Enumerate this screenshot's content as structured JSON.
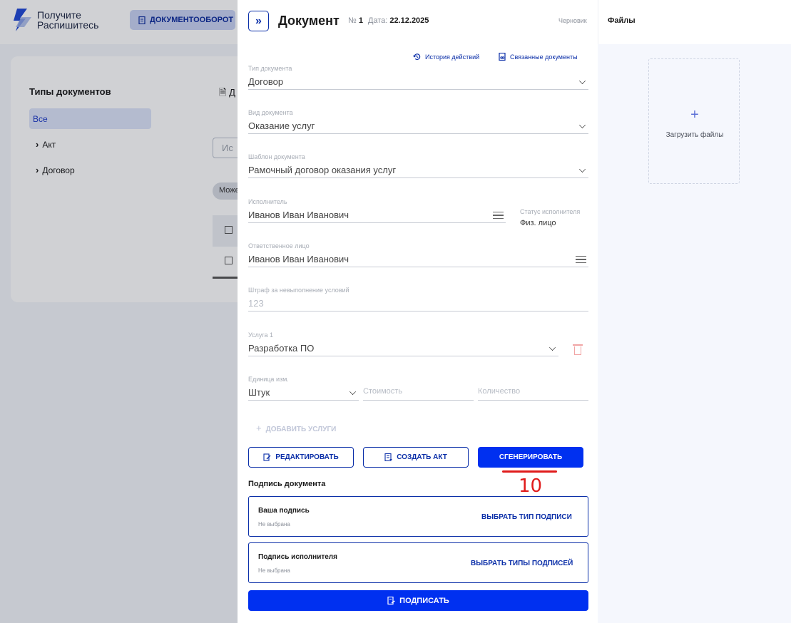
{
  "background": {
    "logo": {
      "line1": "Получите",
      "line2": "Распишитесь"
    },
    "nav_tab": "ДОКУМЕНТООБОРОТ",
    "types_title": "Типы документов",
    "types": [
      "Все",
      "Акт",
      "Договор"
    ],
    "doc_header_fragment": "Д",
    "search_placeholder": "Ис",
    "chip_label": "Може"
  },
  "panel": {
    "title": "Документ",
    "number_label": "№",
    "number_value": "1",
    "date_label": "Дата:",
    "date_value": "22.12.2025",
    "status": "Черновик",
    "links": {
      "history": "История действий",
      "related": "Связанные документы"
    },
    "fields": {
      "doc_type": {
        "label": "Тип документа",
        "value": "Договор"
      },
      "doc_kind": {
        "label": "Вид документа",
        "value": "Оказание услуг"
      },
      "template": {
        "label": "Шаблон документа",
        "value": "Рамочный договор оказания услуг"
      },
      "executor": {
        "label": "Исполнитель",
        "value": "Иванов Иван Иванович"
      },
      "executor_status": {
        "label": "Статус исполнителя",
        "value": "Физ. лицо"
      },
      "responsible": {
        "label": "Ответственное лицо",
        "value": "Иванов Иван Иванович"
      },
      "penalty": {
        "label": "Штраф за невыполнение условий",
        "value": "123"
      },
      "service1": {
        "label": "Услуга 1",
        "value": "Разработка ПО"
      },
      "unit": {
        "label": "Единица изм.",
        "value": "Штук"
      },
      "cost": {
        "placeholder": "Стоимость"
      },
      "quantity": {
        "placeholder": "Количество"
      }
    },
    "add_service": "ДОБАВИТЬ УСЛУГИ",
    "buttons": {
      "edit": "РЕДАКТИРОВАТЬ",
      "create_act": "СОЗДАТЬ АКТ",
      "generate": "СГЕНЕРИРОВАТЬ"
    },
    "annotation_number": "10",
    "signature": {
      "title": "Подпись документа",
      "yours": {
        "title": "Ваша подпись",
        "status": "Не выбрана",
        "action": "ВЫБРАТЬ ТИП ПОДПИСИ"
      },
      "executor": {
        "title": "Подпись исполнителя",
        "status": "Не выбрана",
        "action": "ВЫБРАТЬ ТИПЫ ПОДПИСЕЙ"
      },
      "sign_button": "ПОДПИСАТЬ"
    }
  },
  "files": {
    "title": "Файлы",
    "upload": "Загрузить файлы"
  },
  "colors": {
    "accent": "#0030f0",
    "accent_dark": "#0a2ea8",
    "annotation": "#e01b1b"
  }
}
